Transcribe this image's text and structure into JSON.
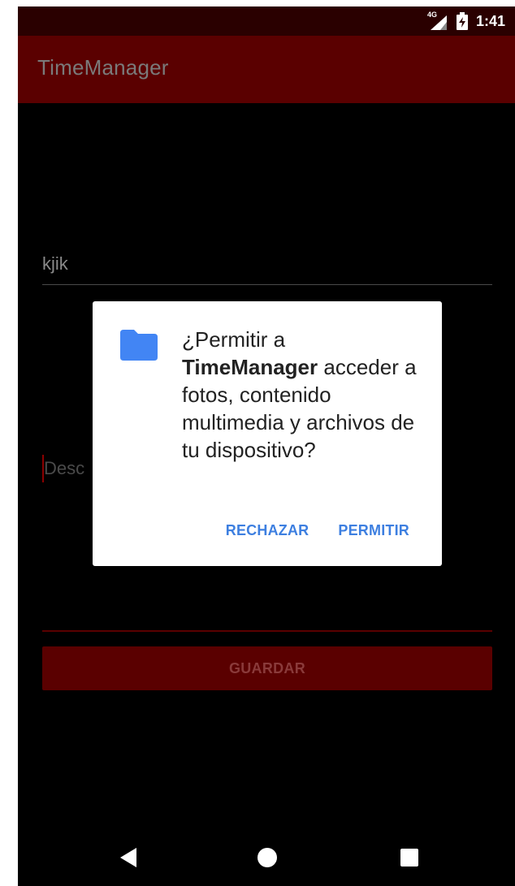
{
  "status_bar": {
    "network_label": "4G",
    "time": "1:41",
    "icons": [
      "signal-icon",
      "battery-charging-icon"
    ]
  },
  "app_bar": {
    "title": "TimeManager"
  },
  "form": {
    "title_value": "kjik",
    "description_placeholder": "Desc",
    "save_label": "GUARDAR"
  },
  "dialog": {
    "icon": "folder-icon",
    "message_prefix": "¿Permitir a ",
    "app_name": "TimeManager",
    "message_suffix": " acceder a fotos, contenido multimedia y archivos de tu dispositivo?",
    "deny_label": "RECHAZAR",
    "allow_label": "PERMITIR"
  },
  "nav_bar": {
    "icons": [
      "back-icon",
      "home-icon",
      "recents-icon"
    ]
  },
  "colors": {
    "status_bar": "#2a0000",
    "app_bar": "#5a0000",
    "accent": "#3d7fe0",
    "folder": "#4285f4"
  }
}
